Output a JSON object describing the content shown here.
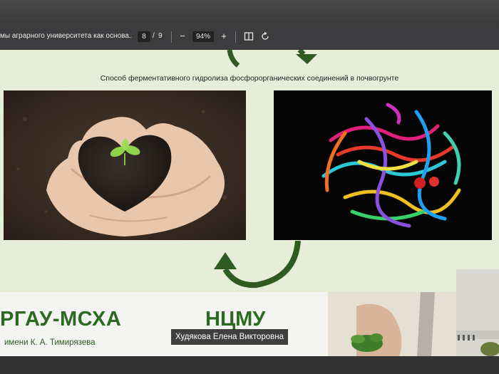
{
  "toolbar": {
    "doc_title": "мы аграрного университета как основа...",
    "page_current": "8",
    "page_separator": "/",
    "page_total": "9",
    "zoom_out_label": "−",
    "zoom_level": "94%",
    "zoom_in_label": "+",
    "icons": [
      "zoom-out-icon",
      "zoom-in-icon",
      "fit-page-icon",
      "rotate-icon"
    ]
  },
  "slide": {
    "caption": "Способ ферментативного гидролиза фосфорорганических соединений в почвогрунте",
    "images": [
      "soil-heart-in-hands-image",
      "protein-ribbon-structure-image"
    ],
    "arrow_color": "#2f5a22",
    "background": "#e6eed9"
  },
  "banner": {
    "org1_name": "РГАУ-МСХА",
    "org1_subtitle": "имени К. А. Тимирязева",
    "org2_name": "НЦМУ",
    "brand_color": "#2c6a22"
  },
  "participant": {
    "name": "Худякова Елена Викторовна"
  }
}
